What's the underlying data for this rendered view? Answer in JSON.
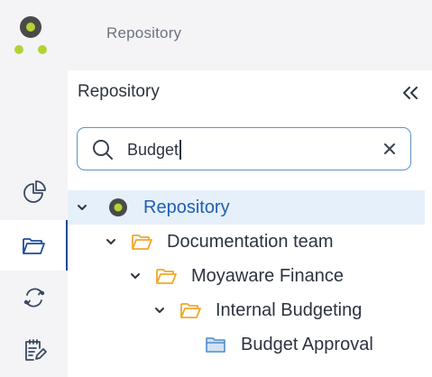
{
  "header": {
    "breadcrumb": "Repository"
  },
  "rail": {
    "items": [
      {
        "icon": "pie-chart-icon"
      },
      {
        "icon": "folder-icon",
        "active": true
      },
      {
        "icon": "sync-icon"
      },
      {
        "icon": "checklist-edit-icon"
      }
    ]
  },
  "panel": {
    "title": "Repository",
    "search": {
      "value": "Budget",
      "placeholder": ""
    }
  },
  "tree": {
    "root": {
      "label": "Repository",
      "selected": true
    },
    "level1": {
      "label": "Documentation team"
    },
    "level2": {
      "label": "Moyaware Finance"
    },
    "level3": {
      "label": "Internal Budgeting"
    },
    "leaf": {
      "label": "Budget Approval"
    }
  },
  "colors": {
    "accent": "#1f5fb5",
    "logo_dark": "#4a4a4a",
    "logo_lime": "#b3d334",
    "folder_orange": "#f0a72c",
    "folder_blue": "#6aa6dc",
    "selected_row_bg": "#e6f0fa"
  }
}
